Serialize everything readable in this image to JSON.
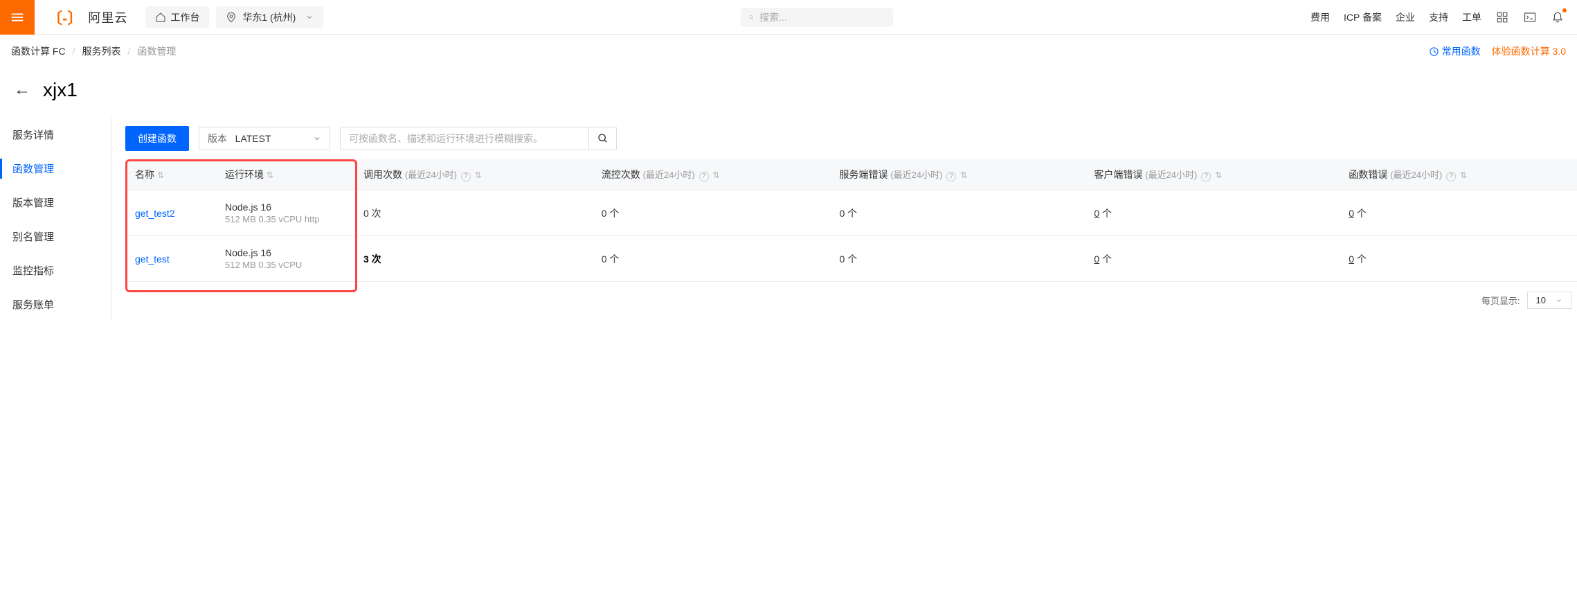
{
  "header": {
    "logo_text": "阿里云",
    "workspace_label": "工作台",
    "region_label": "华东1 (杭州)",
    "search_placeholder": "搜索...",
    "right_links": [
      "费用",
      "ICP 备案",
      "企业",
      "支持",
      "工单"
    ]
  },
  "breadcrumb": {
    "items": [
      "函数计算 FC",
      "服务列表",
      "函数管理"
    ],
    "right_link_blue": "常用函数",
    "right_link_orange": "体验函数计算 3.0"
  },
  "page": {
    "title": "xjx1"
  },
  "sidebar": {
    "items": [
      "服务详情",
      "函数管理",
      "版本管理",
      "别名管理",
      "监控指标",
      "服务账单"
    ],
    "active_index": 1
  },
  "toolbar": {
    "create_label": "创建函数",
    "version_label": "版本",
    "version_value": "LATEST",
    "func_search_placeholder": "可按函数名、描述和运行环境进行模糊搜索。"
  },
  "table": {
    "columns": {
      "name": "名称",
      "runtime": "运行环境",
      "invocations": {
        "main": "调用次数",
        "sub": "(最近24小时)"
      },
      "throttled": {
        "main": "流控次数",
        "sub": "(最近24小时)"
      },
      "server_errors": {
        "main": "服务端错误",
        "sub": "(最近24小时)"
      },
      "client_errors": {
        "main": "客户端错误",
        "sub": "(最近24小时)"
      },
      "func_errors": {
        "main": "函数错误",
        "sub": "(最近24小时)"
      }
    },
    "rows": [
      {
        "name": "get_test2",
        "runtime": "Node.js 16",
        "runtime_sub": "512 MB   0.35 vCPU   http",
        "invocations": "0 次",
        "throttled": "0 个",
        "server_errors": "0 个",
        "client_errors_num": "0",
        "client_errors_unit": " 个",
        "func_errors_num": "0",
        "func_errors_unit": " 个"
      },
      {
        "name": "get_test",
        "runtime": "Node.js 16",
        "runtime_sub": "512 MB   0.35 vCPU",
        "invocations": "3 次",
        "throttled": "0 个",
        "server_errors": "0 个",
        "client_errors_num": "0",
        "client_errors_unit": " 个",
        "func_errors_num": "0",
        "func_errors_unit": " 个"
      }
    ]
  },
  "pagination": {
    "label": "每页显示:",
    "size": "10"
  }
}
